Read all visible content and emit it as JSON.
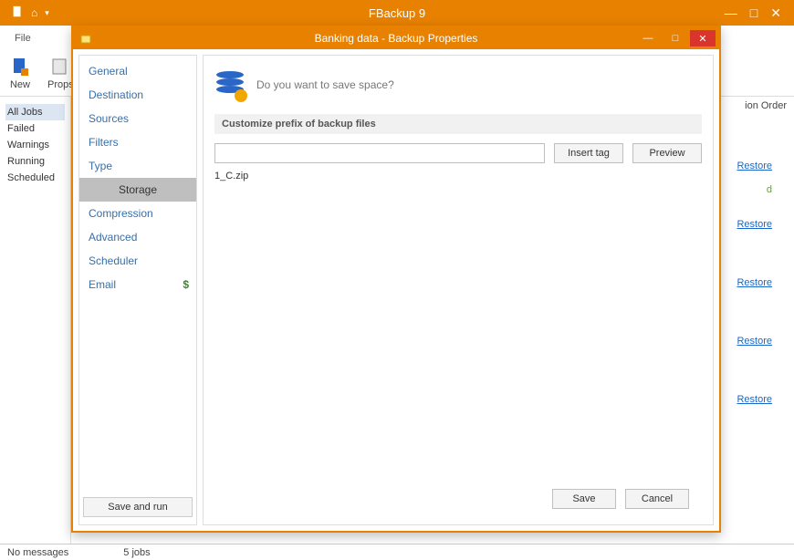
{
  "app": {
    "title": "FBackup 9",
    "menu_file": "File",
    "new_label": "New",
    "props_label": "Props",
    "sysbtn_min": "—",
    "sysbtn_restore": "□",
    "sysbtn_close": "✕"
  },
  "categories": {
    "all": "All Jobs",
    "failed": "Failed",
    "warnings": "Warnings",
    "running": "Running",
    "scheduled": "Scheduled"
  },
  "grid": {
    "col_order": "ion Order",
    "restore": "Restore",
    "unknown": "d"
  },
  "status": {
    "msgs": "No messages",
    "jobs": "5 jobs"
  },
  "dialog": {
    "title": "Banking data - Backup Properties",
    "nav": {
      "general": "General",
      "destination": "Destination",
      "sources": "Sources",
      "filters": "Filters",
      "type": "Type",
      "storage": "Storage",
      "compression": "Compression",
      "advanced": "Advanced",
      "scheduler": "Scheduler",
      "email": "Email"
    },
    "save_and_run": "Save and run",
    "hero_text": "Do you want to save space?",
    "section_head": "Customize prefix of backup files",
    "insert_tag": "Insert tag",
    "preview": "Preview",
    "example": "1_C.zip",
    "save": "Save",
    "cancel": "Cancel",
    "prefix_value": ""
  }
}
